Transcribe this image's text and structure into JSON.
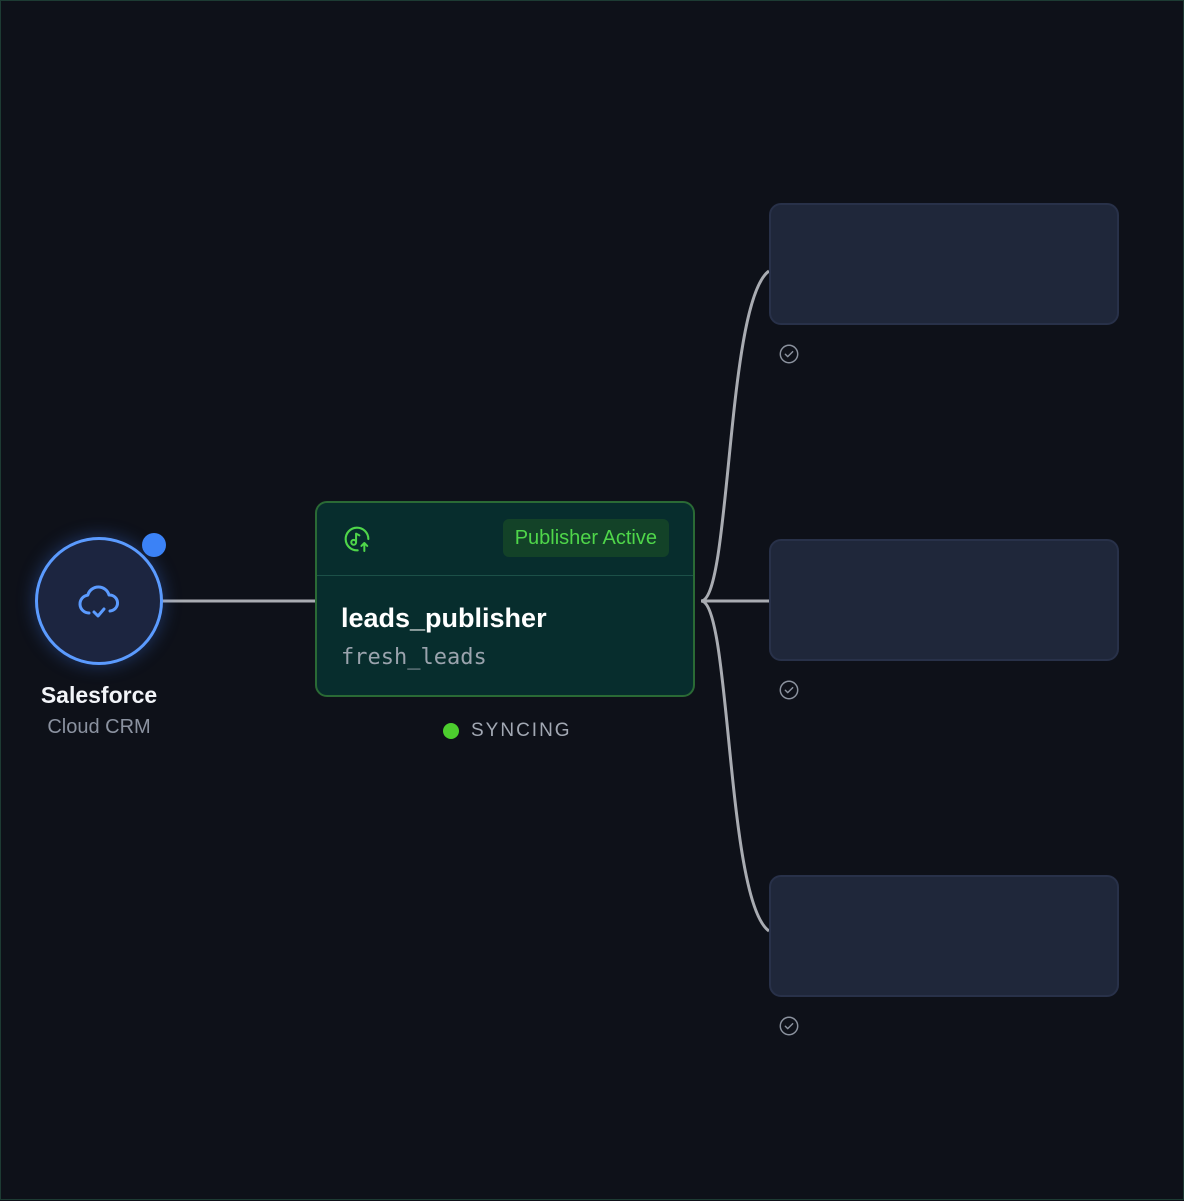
{
  "source": {
    "name": "Salesforce",
    "subtitle": "Cloud CRM",
    "icon": "cloud-check-icon",
    "accent_color": "#5b9bff",
    "notification_dot_color": "#3b82f6"
  },
  "publisher": {
    "badge": "Publisher Active",
    "name": "leads_publisher",
    "topic": "fresh_leads",
    "icon": "publish-icon",
    "accent_color": "#4fd64a"
  },
  "status": {
    "text": "SYNCING",
    "color": "#4ccd2e"
  },
  "consumers": [
    {
      "icon": "check-circle-icon"
    },
    {
      "icon": "check-circle-icon"
    },
    {
      "icon": "check-circle-icon"
    }
  ]
}
